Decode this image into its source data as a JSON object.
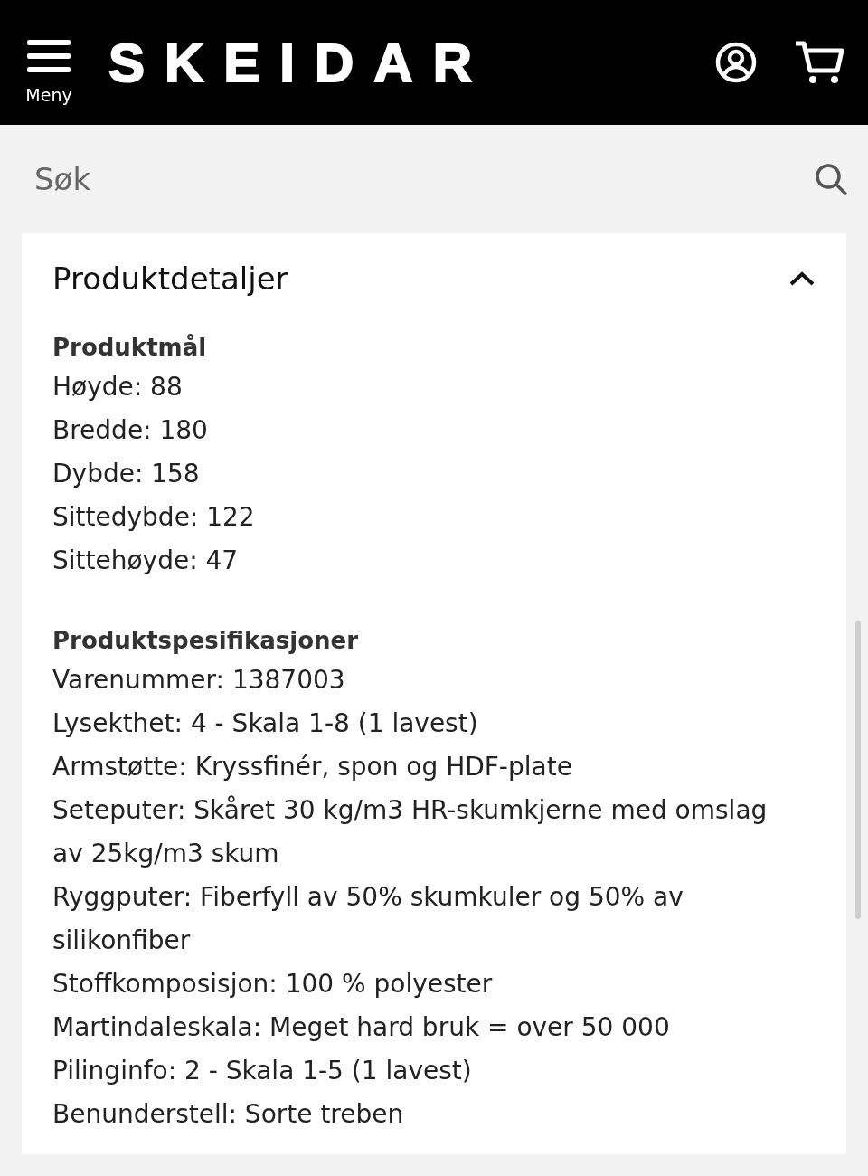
{
  "header": {
    "menu_label": "Meny",
    "logo": "SKEIDAR"
  },
  "search": {
    "placeholder": "Søk"
  },
  "panel": {
    "title": "Produktdetaljer",
    "expanded": true,
    "sections": [
      {
        "heading": "Produktmål",
        "lines": [
          "Høyde: 88",
          "Bredde: 180",
          "Dybde: 158",
          "Sittedybde: 122",
          "Sittehøyde: 47"
        ]
      },
      {
        "heading": "Produktspesifikasjoner",
        "lines": [
          "Varenummer: 1387003",
          "Lysekthet: 4 - Skala 1-8 (1 lavest)",
          "Armstøtte: Kryssfinér, spon og HDF-plate",
          "Seteputer: Skåret 30 kg/m3 HR-skumkjerne med omslag av 25kg/m3 skum",
          "Ryggputer: Fiberfyll av 50% skumkuler og 50% av silikonfiber",
          "Stoffkomposisjon: 100 % polyester",
          "Martindaleskala: Meget hard bruk = over 50 000",
          "Pilinginfo: 2 - Skala 1-5 (1 lavest)",
          "Benunderstell: Sorte treben"
        ]
      }
    ]
  }
}
